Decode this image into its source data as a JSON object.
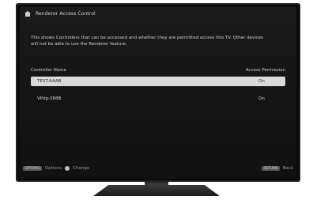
{
  "window": {
    "title": "Renderer Access Control"
  },
  "description": "This shows Controllers that can be accessed and whether they are permitted access this TV. Other devices will not be able to use the Renderer feature.",
  "table": {
    "headers": {
      "name": "Controller Name",
      "permission": "Access Permission"
    },
    "rows": [
      {
        "name": "TEST-AAAB",
        "permission": "On"
      },
      {
        "name": "VPdp-388B",
        "permission": "On"
      }
    ]
  },
  "footer": {
    "options_key": "OPTIONS",
    "options_label": "Options",
    "change_label": "Change",
    "return_key": "RETURN",
    "back_label": "Back"
  },
  "colors": {
    "screen_bg": "#141414",
    "selected_row_bg": "#d9d9d9",
    "text": "#d8d8d8"
  }
}
